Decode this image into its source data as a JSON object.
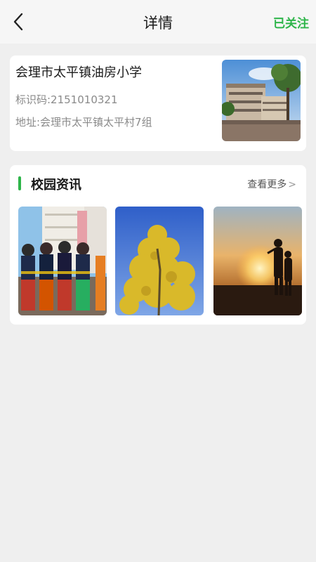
{
  "header": {
    "title": "详情",
    "follow_label": "已关注"
  },
  "school": {
    "name": "会理市太平镇油房小学",
    "code_text": "标识码:2151010321",
    "address_text": "地址:会理市太平镇太平村7组"
  },
  "news": {
    "section_title": "校园资讯",
    "more_label": "查看更多",
    "more_chevron": ">"
  },
  "colors": {
    "accent": "#2eb54a",
    "background": "#efefef"
  }
}
